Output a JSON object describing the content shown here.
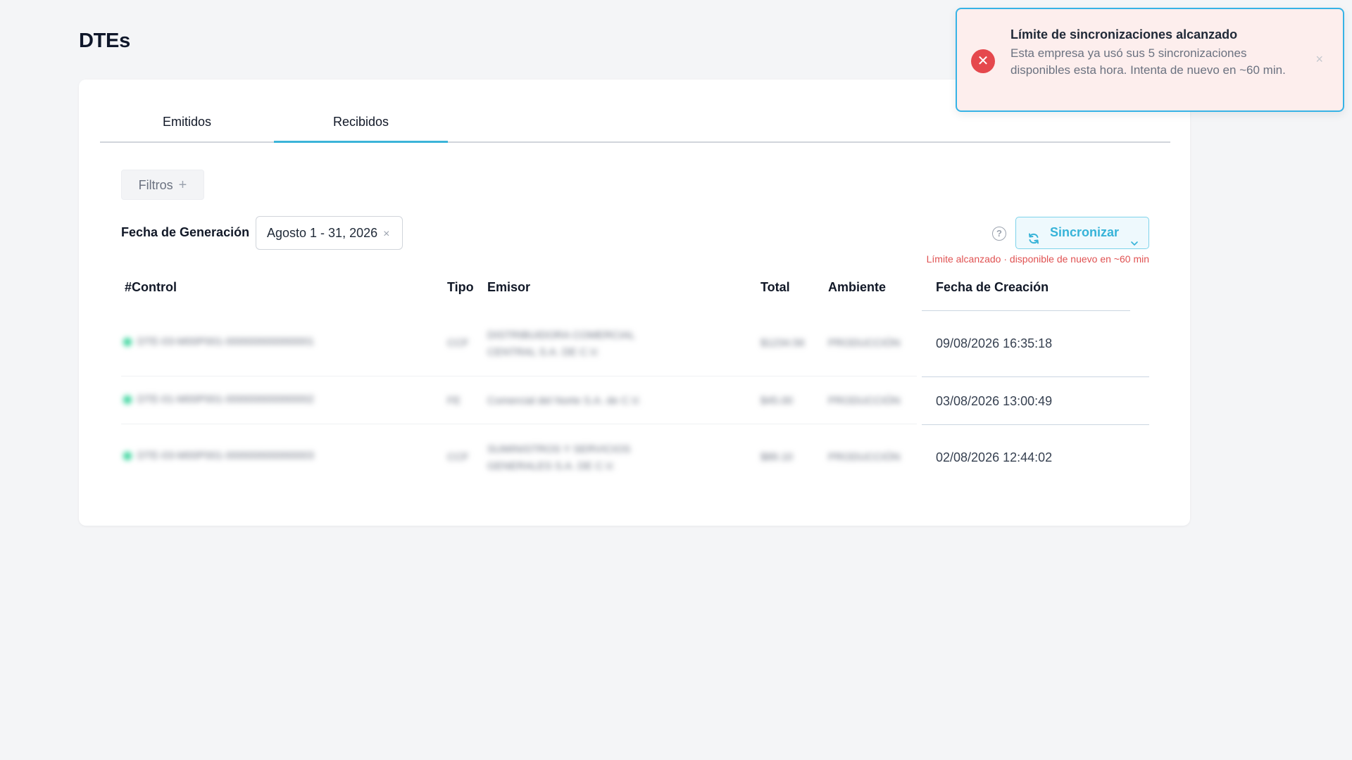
{
  "page": {
    "title": "DTEs"
  },
  "tabs": [
    {
      "label": "Emitidos",
      "active": false
    },
    {
      "label": "Recibidos",
      "active": true
    }
  ],
  "filters": {
    "button_label": "Filtros",
    "plus_symbol": "+",
    "date_label": "Fecha de Generación",
    "date_value": "Agosto 1 - 31, 2026",
    "clear_symbol": "×"
  },
  "sync": {
    "help_symbol": "?",
    "button_label": "Sincronizar",
    "limit_message": "Límite alcanzado · disponible de nuevo en ~60 min"
  },
  "table": {
    "headers": {
      "control": "#Control",
      "tipo": "Tipo",
      "emisor": "Emisor",
      "total": "Total",
      "ambiente": "Ambiente",
      "fecha_creacion": "Fecha de Creación"
    },
    "rows": [
      {
        "fecha": "09/08/2026 16:35:18"
      },
      {
        "fecha": "03/08/2026 13:00:49"
      },
      {
        "fecha": "02/08/2026 12:44:02"
      }
    ]
  },
  "toast": {
    "title": "Límite de sincronizaciones alcanzado",
    "message": "Esta empresa ya usó sus 5 sincronizaciones disponibles esta hora. Intenta de nuevo en ~60 min.",
    "icon": "error-icon",
    "close_symbol": "×"
  },
  "colors": {
    "accent": "#36b3d8",
    "error": "#e5484d",
    "success_dot": "#34d399",
    "toast_background": "#fdeeed"
  }
}
